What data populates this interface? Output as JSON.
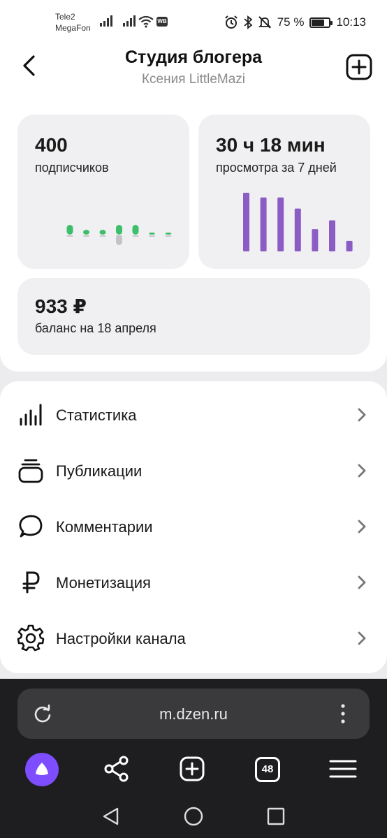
{
  "status_bar": {
    "carrier1": "Tele2",
    "carrier2": "MegaFon",
    "wb_badge": "WB",
    "battery_percent": "75 %",
    "battery_level": 0.75,
    "time": "10:13",
    "icons": [
      "signal-icon",
      "wifi-icon",
      "alarm-icon",
      "bluetooth-icon",
      "mute-icon",
      "battery-icon"
    ]
  },
  "header": {
    "title": "Студия блогера",
    "subtitle": "Ксения LittleMazi"
  },
  "stats": {
    "subscribers": {
      "value": "400",
      "label": "подписчиков",
      "bars": [
        2,
        1,
        1,
        2,
        2,
        0,
        0
      ],
      "neg_bars": [
        0,
        0,
        0,
        -2,
        0,
        0,
        0
      ]
    },
    "views": {
      "value": "30 ч 18 мин",
      "label": "просмотра за 7 дней",
      "bars": [
        10,
        9.2,
        9.2,
        7.3,
        3.8,
        5.3,
        1.8
      ]
    },
    "balance": {
      "value": "933 ₽",
      "label": "баланс на 18 апреля"
    }
  },
  "menu": [
    {
      "label": "Статистика",
      "icon": "stats-icon"
    },
    {
      "label": "Публикации",
      "icon": "publications-icon"
    },
    {
      "label": "Комментарии",
      "icon": "comment-icon"
    },
    {
      "label": "Монетизация",
      "icon": "ruble-icon"
    },
    {
      "label": "Настройки канала",
      "icon": "settings-icon"
    }
  ],
  "browser": {
    "url": "m.dzen.ru",
    "tabs_count": "48"
  },
  "colors": {
    "accent_purple": "#8b5cc4",
    "accent_green": "#3cbf6a",
    "alice_purple": "#7d4dff"
  }
}
